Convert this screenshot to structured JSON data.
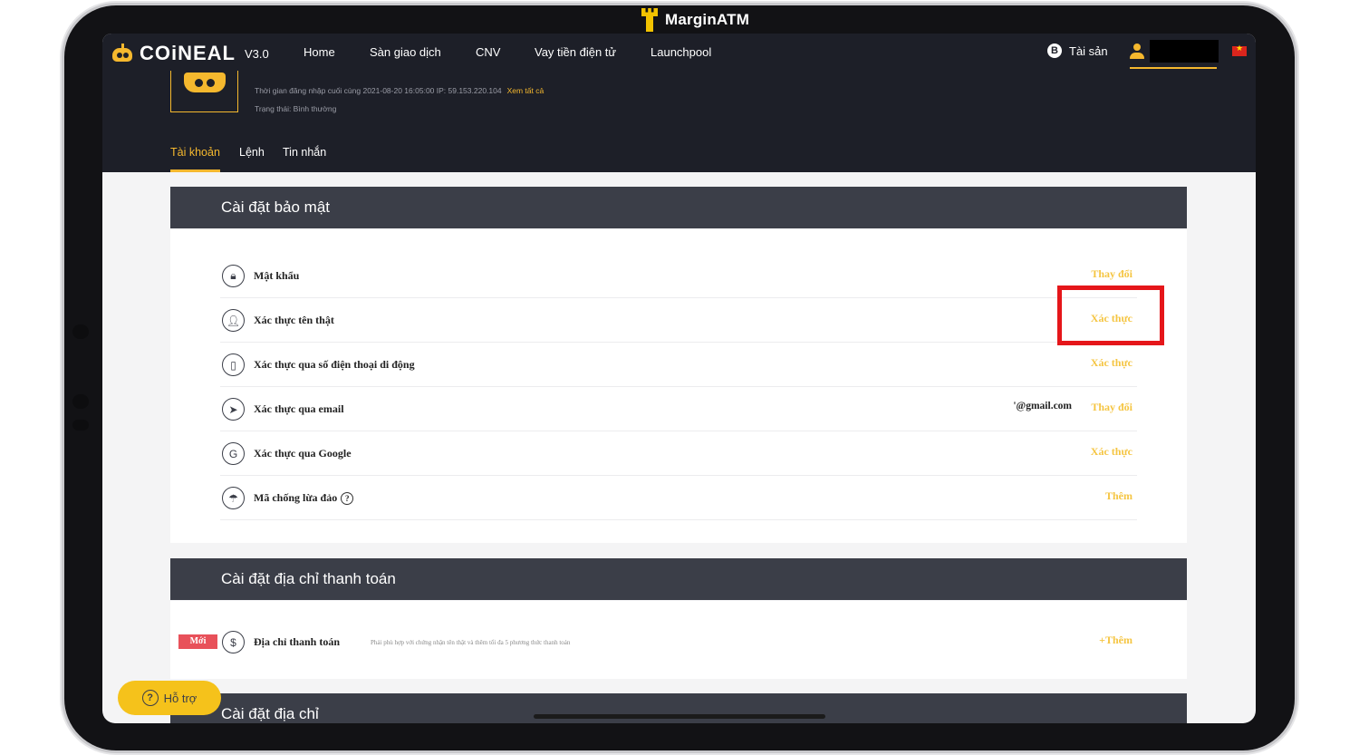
{
  "overlay": {
    "brand": "MarginATM"
  },
  "nav": {
    "logo_text": "COiNEAL",
    "version": "V3.0",
    "items": [
      "Home",
      "Sàn giao dịch",
      "CNV",
      "Vay tiền điện tử",
      "Launchpool"
    ],
    "assets_label": "Tài sản",
    "btc_symbol": "B"
  },
  "profile": {
    "last_login_label": "Thời gian đăng nhập cuối cùng 2021-08-20 16:05:00 IP: 59.153.220.104",
    "view_all": "Xem tất cả",
    "status": "Trạng thái: Bình thường",
    "tabs": [
      "Tài khoản",
      "Lệnh",
      "Tin nhắn"
    ]
  },
  "security": {
    "title": "Cài đặt bảo mật",
    "rows": [
      {
        "label": "Mật khẩu",
        "action": "Thay đổi",
        "icon": "lock-icon"
      },
      {
        "label": "Xác thực tên thật",
        "action": "Xác thực",
        "icon": "person-icon"
      },
      {
        "label": "Xác thực qua số điện thoại di động",
        "action": "Xác thực",
        "icon": "phone-icon"
      },
      {
        "label": "Xác thực qua email",
        "action": "Thay đổi",
        "extra": "'@gmail.com",
        "icon": "send-icon"
      },
      {
        "label": "Xác thực qua Google",
        "action": "Xác thực",
        "icon": "google-icon"
      },
      {
        "label": "Mã chống lừa đảo",
        "action": "Thêm",
        "icon": "umbrella-icon"
      }
    ]
  },
  "payment": {
    "title": "Cài đặt địa chỉ thanh toán",
    "badge": "Mới",
    "label": "Địa chỉ thanh toán",
    "note": "Phải phù hợp với chứng nhận tên thật và thêm tối đa 5 phương thức thanh toán",
    "action": "+Thêm"
  },
  "address": {
    "title": "Cài đặt địa chỉ"
  },
  "support": {
    "label": "Hỗ trợ",
    "icon": "?"
  },
  "colors": {
    "accent": "#f5b82e",
    "highlight": "#e5161a",
    "header": "#3b3e48",
    "dark": "#1d1f28"
  }
}
